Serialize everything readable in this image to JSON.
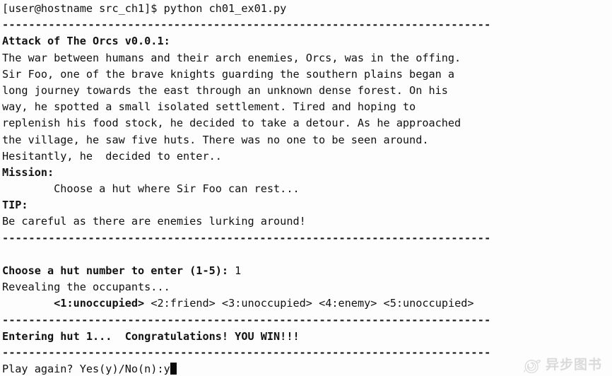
{
  "terminal": {
    "background_color": "#fdfdfd",
    "foreground_color": "#111111",
    "prompt_line": "[user@hostname src_ch1]$ python ch01_ex01.py",
    "separator": "--------------------------------------------------------------------------",
    "separator_short": "--------------------------------------------------------------------------",
    "title": "Attack of The Orcs v0.0.1:",
    "story": [
      "The war between humans and their arch enemies, Orcs, was in the offing.",
      "Sir Foo, one of the brave knights guarding the southern plains began a",
      "long journey towards the east through an unknown dense forest. On his",
      "way, he spotted a small isolated settlement. Tired and hoping to",
      "replenish his food stock, he decided to take a detour. As he approached",
      "the village, he saw five huts. There was no one to be seen around.",
      "Hesitantly, he  decided to enter.."
    ],
    "mission_label": "Mission:",
    "mission_text": "        Choose a hut where Sir Foo can rest...",
    "tip_label": "TIP:",
    "tip_text": "Be careful as there are enemies lurking around!",
    "prompt_choose_label": "Choose a hut number to enter (1-5): ",
    "prompt_choose_value": "1",
    "revealing_text": "Revealing the occupants...",
    "occupants_indent": "        ",
    "occupants": [
      {
        "text": "<1:unoccupied>",
        "bold": true
      },
      {
        "text": "<2:friend>",
        "bold": false
      },
      {
        "text": "<3:unoccupied>",
        "bold": false
      },
      {
        "text": "<4:enemy>",
        "bold": false
      },
      {
        "text": "<5:unoccupied>",
        "bold": false
      }
    ],
    "result_line": "Entering hut 1...  Congratulations! YOU WIN!!!",
    "play_again_label": "Play again? Yes(y)/No(n):",
    "play_again_value": "y",
    "cursor_visible": true
  },
  "watermark": {
    "text": "异步图书",
    "logo_name": "snail-logo"
  }
}
